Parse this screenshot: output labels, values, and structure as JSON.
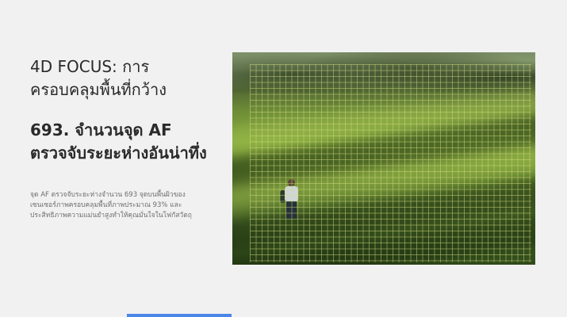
{
  "feature": {
    "heading": "4D FOCUS: การครอบคลุมพื้นที่กว้าง",
    "subheading": "693. จำนวนจุด AF ตรวจจับระยะห่างอันน่าทึ่ง",
    "description": "จุด AF ตรวจจับระยะห่างจำนวน 693 จุดบนพื้นผิวของเซนเซอร์ภาพครอบคลุมพื้นที่ภาพประมาณ 93% และประสิทธิภาพความแม่นยำสูงทำให้คุณมั่นใจในโฟกัสวัตถุ"
  },
  "colors": {
    "background": "#f1f1f1",
    "accent": "#4a86e8",
    "af_grid": "#d2dc82"
  }
}
